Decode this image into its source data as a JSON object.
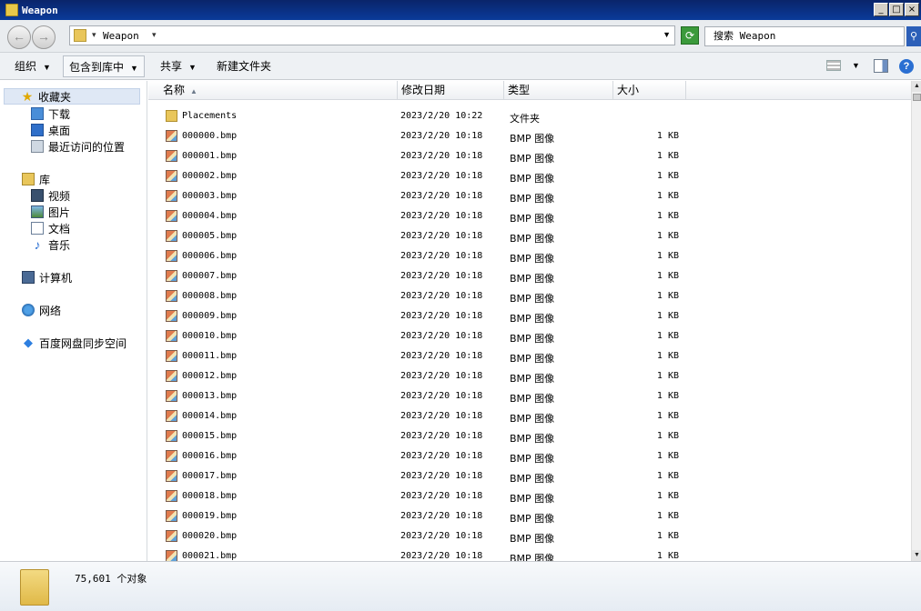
{
  "window": {
    "title": "Weapon"
  },
  "address": {
    "path": "Weapon"
  },
  "search": {
    "placeholder": "搜索 Weapon"
  },
  "toolbar": {
    "organize": "组织",
    "include_in_library": "包含到库中",
    "share": "共享",
    "new_folder": "新建文件夹"
  },
  "sidebar": {
    "favorites": "收藏夹",
    "downloads": "下载",
    "desktop": "桌面",
    "recent": "最近访问的位置",
    "libraries": "库",
    "videos": "视频",
    "pictures": "图片",
    "documents": "文档",
    "music": "音乐",
    "computer": "计算机",
    "network": "网络",
    "baidu_sync": "百度网盘同步空间"
  },
  "columns": {
    "name": "名称",
    "date": "修改日期",
    "type": "类型",
    "size": "大小"
  },
  "files": [
    {
      "name": "Placements",
      "date": "2023/2/20 10:22",
      "type": "文件夹",
      "size": "",
      "kind": "folder"
    },
    {
      "name": "000000.bmp",
      "date": "2023/2/20 10:18",
      "type": "BMP 图像",
      "size": "1 KB",
      "kind": "bmp"
    },
    {
      "name": "000001.bmp",
      "date": "2023/2/20 10:18",
      "type": "BMP 图像",
      "size": "1 KB",
      "kind": "bmp"
    },
    {
      "name": "000002.bmp",
      "date": "2023/2/20 10:18",
      "type": "BMP 图像",
      "size": "1 KB",
      "kind": "bmp"
    },
    {
      "name": "000003.bmp",
      "date": "2023/2/20 10:18",
      "type": "BMP 图像",
      "size": "1 KB",
      "kind": "bmp"
    },
    {
      "name": "000004.bmp",
      "date": "2023/2/20 10:18",
      "type": "BMP 图像",
      "size": "1 KB",
      "kind": "bmp"
    },
    {
      "name": "000005.bmp",
      "date": "2023/2/20 10:18",
      "type": "BMP 图像",
      "size": "1 KB",
      "kind": "bmp"
    },
    {
      "name": "000006.bmp",
      "date": "2023/2/20 10:18",
      "type": "BMP 图像",
      "size": "1 KB",
      "kind": "bmp"
    },
    {
      "name": "000007.bmp",
      "date": "2023/2/20 10:18",
      "type": "BMP 图像",
      "size": "1 KB",
      "kind": "bmp"
    },
    {
      "name": "000008.bmp",
      "date": "2023/2/20 10:18",
      "type": "BMP 图像",
      "size": "1 KB",
      "kind": "bmp"
    },
    {
      "name": "000009.bmp",
      "date": "2023/2/20 10:18",
      "type": "BMP 图像",
      "size": "1 KB",
      "kind": "bmp"
    },
    {
      "name": "000010.bmp",
      "date": "2023/2/20 10:18",
      "type": "BMP 图像",
      "size": "1 KB",
      "kind": "bmp"
    },
    {
      "name": "000011.bmp",
      "date": "2023/2/20 10:18",
      "type": "BMP 图像",
      "size": "1 KB",
      "kind": "bmp"
    },
    {
      "name": "000012.bmp",
      "date": "2023/2/20 10:18",
      "type": "BMP 图像",
      "size": "1 KB",
      "kind": "bmp"
    },
    {
      "name": "000013.bmp",
      "date": "2023/2/20 10:18",
      "type": "BMP 图像",
      "size": "1 KB",
      "kind": "bmp"
    },
    {
      "name": "000014.bmp",
      "date": "2023/2/20 10:18",
      "type": "BMP 图像",
      "size": "1 KB",
      "kind": "bmp"
    },
    {
      "name": "000015.bmp",
      "date": "2023/2/20 10:18",
      "type": "BMP 图像",
      "size": "1 KB",
      "kind": "bmp"
    },
    {
      "name": "000016.bmp",
      "date": "2023/2/20 10:18",
      "type": "BMP 图像",
      "size": "1 KB",
      "kind": "bmp"
    },
    {
      "name": "000017.bmp",
      "date": "2023/2/20 10:18",
      "type": "BMP 图像",
      "size": "1 KB",
      "kind": "bmp"
    },
    {
      "name": "000018.bmp",
      "date": "2023/2/20 10:18",
      "type": "BMP 图像",
      "size": "1 KB",
      "kind": "bmp"
    },
    {
      "name": "000019.bmp",
      "date": "2023/2/20 10:18",
      "type": "BMP 图像",
      "size": "1 KB",
      "kind": "bmp"
    },
    {
      "name": "000020.bmp",
      "date": "2023/2/20 10:18",
      "type": "BMP 图像",
      "size": "1 KB",
      "kind": "bmp"
    },
    {
      "name": "000021.bmp",
      "date": "2023/2/20 10:18",
      "type": "BMP 图像",
      "size": "1 KB",
      "kind": "bmp"
    }
  ],
  "status": {
    "count": "75,601 个对象"
  }
}
